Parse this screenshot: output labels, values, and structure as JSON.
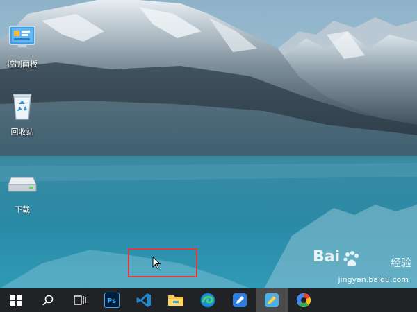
{
  "desktop": {
    "icons": [
      {
        "label": "控制面板",
        "icon": "control-panel-icon"
      },
      {
        "label": "回收站",
        "icon": "recycle-bin-icon"
      },
      {
        "label": "下载",
        "icon": "drive-icon"
      }
    ]
  },
  "taskbar": {
    "items": [
      {
        "icon": "windows-start-icon"
      },
      {
        "icon": "search-icon"
      },
      {
        "icon": "task-view-icon"
      },
      {
        "icon": "photoshop-icon",
        "text": "Ps"
      },
      {
        "icon": "vscode-icon"
      },
      {
        "icon": "file-explorer-icon"
      },
      {
        "icon": "edge-icon"
      },
      {
        "icon": "pen-app-icon"
      },
      {
        "icon": "pencil-app-icon",
        "active": true
      },
      {
        "icon": "color-app-icon"
      }
    ]
  },
  "watermark": {
    "brand": "Bai",
    "brand_suffix": "经验",
    "url": "jingyan.baidu.com"
  },
  "colors": {
    "highlight": "#e03a3a",
    "taskbar": "#202225",
    "lake": "#2a8aa6"
  }
}
